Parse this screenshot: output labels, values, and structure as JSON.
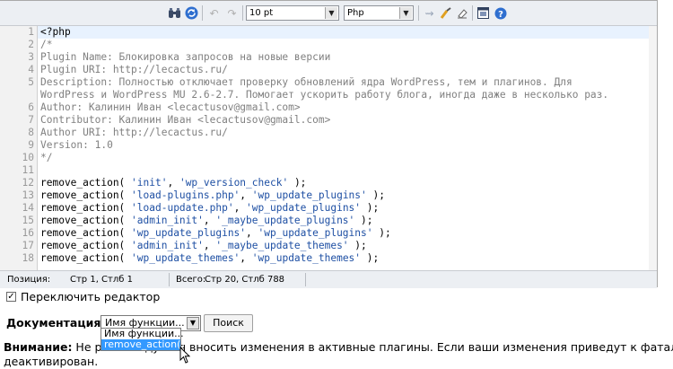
{
  "toolbar": {
    "font_size_value": "10 pt",
    "language_value": "Php",
    "icons": [
      "binoculars-icon",
      "refresh-icon",
      "undo-icon",
      "redo-icon",
      "wand-icon",
      "brush-icon",
      "eraser-icon",
      "window-icon",
      "help-icon"
    ]
  },
  "code": {
    "lines": [
      {
        "n": "1",
        "segments": [
          {
            "t": "<?php",
            "c": "kw"
          }
        ]
      },
      {
        "n": "2",
        "segments": [
          {
            "t": "/*",
            "c": "cm"
          }
        ]
      },
      {
        "n": "3",
        "segments": [
          {
            "t": "Plugin Name: Блокировка запросов на новые версии",
            "c": "cm"
          }
        ]
      },
      {
        "n": "4",
        "segments": [
          {
            "t": "Plugin URI: http://lecactus.ru/",
            "c": "cm"
          }
        ]
      },
      {
        "n": "5",
        "segments": [
          {
            "t": "Description: Полностью отключает проверку обновлений ядра WordPress, тем и плагинов. Для",
            "c": "cm"
          }
        ]
      },
      {
        "n": "",
        "segments": [
          {
            "t": "WordPress и WordPress MU 2.6-2.7. Помогает ускорить работу блога, иногда даже в несколько раз.",
            "c": "cm"
          }
        ]
      },
      {
        "n": "6",
        "segments": [
          {
            "t": "Author: Калинин Иван <lecactusov@gmail.com>",
            "c": "cm"
          }
        ]
      },
      {
        "n": "7",
        "segments": [
          {
            "t": "Contributor: Калинин Иван <lecactusov@gmail.com>",
            "c": "cm"
          }
        ]
      },
      {
        "n": "8",
        "segments": [
          {
            "t": "Author URI: http://lecactus.ru/",
            "c": "cm"
          }
        ]
      },
      {
        "n": "9",
        "segments": [
          {
            "t": "Version: 1.0",
            "c": "cm"
          }
        ]
      },
      {
        "n": "10",
        "segments": [
          {
            "t": "*/",
            "c": "cm"
          }
        ]
      },
      {
        "n": "11",
        "segments": [
          {
            "t": "",
            "c": "kw"
          }
        ]
      },
      {
        "n": "12",
        "segments": [
          {
            "t": "remove_action( ",
            "c": "kw"
          },
          {
            "t": "'init'",
            "c": "st"
          },
          {
            "t": ", ",
            "c": "kw"
          },
          {
            "t": "'wp_version_check'",
            "c": "st"
          },
          {
            "t": " );",
            "c": "kw"
          }
        ]
      },
      {
        "n": "13",
        "segments": [
          {
            "t": "remove_action( ",
            "c": "kw"
          },
          {
            "t": "'load-plugins.php'",
            "c": "st"
          },
          {
            "t": ", ",
            "c": "kw"
          },
          {
            "t": "'wp_update_plugins'",
            "c": "st"
          },
          {
            "t": " );",
            "c": "kw"
          }
        ]
      },
      {
        "n": "14",
        "segments": [
          {
            "t": "remove_action( ",
            "c": "kw"
          },
          {
            "t": "'load-update.php'",
            "c": "st"
          },
          {
            "t": ", ",
            "c": "kw"
          },
          {
            "t": "'wp_update_plugins'",
            "c": "st"
          },
          {
            "t": " );",
            "c": "kw"
          }
        ]
      },
      {
        "n": "15",
        "segments": [
          {
            "t": "remove_action( ",
            "c": "kw"
          },
          {
            "t": "'admin_init'",
            "c": "st"
          },
          {
            "t": ", ",
            "c": "kw"
          },
          {
            "t": "'_maybe_update_plugins'",
            "c": "st"
          },
          {
            "t": " );",
            "c": "kw"
          }
        ]
      },
      {
        "n": "16",
        "segments": [
          {
            "t": "remove_action( ",
            "c": "kw"
          },
          {
            "t": "'wp_update_plugins'",
            "c": "st"
          },
          {
            "t": ", ",
            "c": "kw"
          },
          {
            "t": "'wp_update_plugins'",
            "c": "st"
          },
          {
            "t": " );",
            "c": "kw"
          }
        ]
      },
      {
        "n": "17",
        "segments": [
          {
            "t": "remove_action( ",
            "c": "kw"
          },
          {
            "t": "'admin_init'",
            "c": "st"
          },
          {
            "t": ", ",
            "c": "kw"
          },
          {
            "t": "'_maybe_update_themes'",
            "c": "st"
          },
          {
            "t": " );",
            "c": "kw"
          }
        ]
      },
      {
        "n": "18",
        "segments": [
          {
            "t": "remove_action( ",
            "c": "kw"
          },
          {
            "t": "'wp_update_themes'",
            "c": "st"
          },
          {
            "t": ", ",
            "c": "kw"
          },
          {
            "t": "'wp_update_themes'",
            "c": "st"
          },
          {
            "t": " );",
            "c": "kw"
          }
        ]
      }
    ]
  },
  "status": {
    "position_label": "Позиция:",
    "position_value": "Стр 1, Стлб 1",
    "total_label": "Всего:",
    "total_value": "Стр 20, Стлб 788"
  },
  "toggle_editor": {
    "label": "Переключить редактор",
    "checked": "✓"
  },
  "documentation": {
    "label": "Документация:",
    "select_value": "Имя функции...",
    "search_button": "Поиск",
    "options": [
      "Имя функции...",
      "remove_action()"
    ]
  },
  "warning": {
    "bold": "Внимание:",
    "line1": " Не рекомендуется вносить изменения в активные плагины. Если ваши изменения приведут к фатальной ошибке, плаг",
    "line2": "деактивирован."
  },
  "colors": {
    "comment": "#808080",
    "string": "#1e4fa3",
    "toolbar_bg": "#eceff3",
    "selection": "#3399ff"
  }
}
